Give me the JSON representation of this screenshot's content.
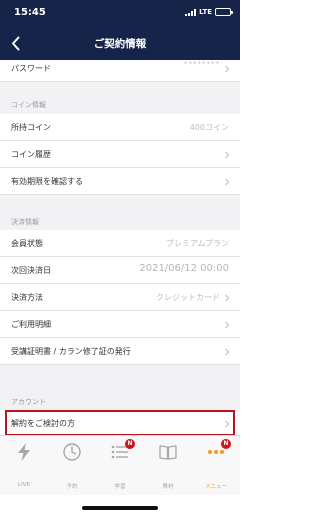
{
  "status_bar": {
    "time": "15:45",
    "network": "LTE"
  },
  "header": {
    "title": "ご契約情報"
  },
  "account": {
    "password_label": "パスワード",
    "password_value": "********"
  },
  "coin_section": {
    "title": "コイン情報",
    "balance_label": "所持コイン",
    "balance_value": "400コイン",
    "history_label": "コイン履歴",
    "expiry_label": "有効期限を確認する"
  },
  "payment_section": {
    "title": "決済情報",
    "membership_label": "会員状態",
    "membership_value": "プレミアムプラン",
    "next_payment_label": "次回決済日",
    "next_payment_value": "2021/06/12 00:00",
    "method_label": "決済方法",
    "method_value": "クレジットカード",
    "statement_label": "ご利用明細",
    "certificate_label": "受講証明書 / カラン修了証の発行"
  },
  "account_section": {
    "title": "アカウント",
    "cancel_label": "解約をご検討の方"
  },
  "tab_bar": {
    "live_label": "LIVE",
    "reserve_label": "予約",
    "study_label": "学習",
    "study_badge": "N",
    "materials_label": "教材",
    "menu_label": "メニュー",
    "menu_badge": "N"
  },
  "colors": {
    "nav_bg": "#16244a",
    "accent": "#f19b22",
    "badge": "#d0151c",
    "highlight": "#b8151f"
  }
}
